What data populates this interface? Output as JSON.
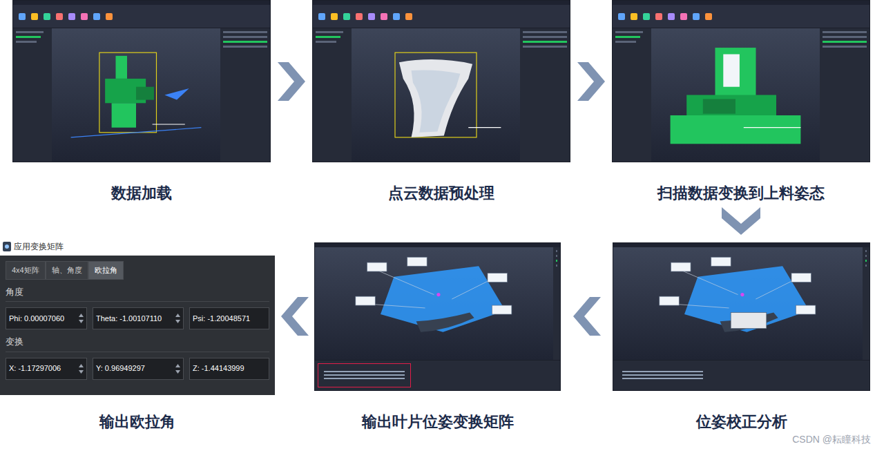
{
  "steps": [
    {
      "caption": "数据加载",
      "kind": "load",
      "highlighted": false
    },
    {
      "caption": "点云数据预处理",
      "kind": "preprocess",
      "highlighted": false
    },
    {
      "caption": "扫描数据变换到上料姿态",
      "kind": "transform",
      "highlighted": false
    },
    {
      "caption": "位姿校正分析",
      "kind": "analysis",
      "highlighted": false
    },
    {
      "caption": "输出叶片位姿变换矩阵",
      "kind": "matrix",
      "highlighted": true
    },
    {
      "caption": "输出欧拉角",
      "kind": "euler",
      "highlighted": false
    }
  ],
  "euler_dialog": {
    "title": "应用变换矩阵",
    "tabs": [
      {
        "label": "4x4矩阵",
        "selected": false
      },
      {
        "label": "轴、角度",
        "selected": false
      },
      {
        "label": "欧拉角",
        "selected": true
      }
    ],
    "sections": [
      {
        "label": "角度",
        "fields": [
          "Phi: 0.00007060",
          "Theta: -1.00107110",
          "Psi: -1.20048571"
        ]
      },
      {
        "label": "变换",
        "fields": [
          "X: -1.17297006",
          "Y: 0.96949297",
          "Z: -1.44143999"
        ]
      }
    ]
  },
  "watermark": "CSDN @耘瞳科技"
}
